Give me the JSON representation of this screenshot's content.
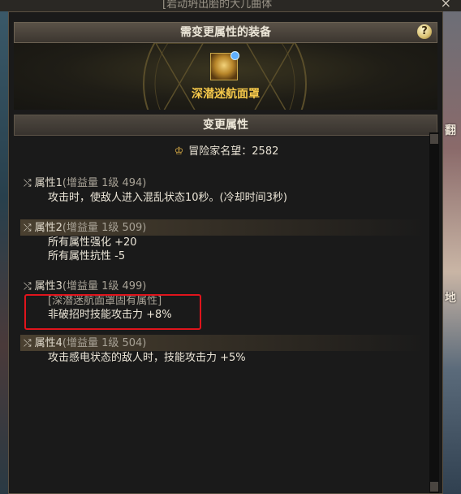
{
  "window": {
    "title": "[岩动坍出胎的大几曲体",
    "close_label": "×"
  },
  "equip_section": {
    "header": "需变更属性的装备",
    "help_label": "?",
    "item_name": "深潜迷航面罩"
  },
  "change_section": {
    "header": "变更属性",
    "fame_label": "冒险家名望：2582"
  },
  "attributes": [
    {
      "name": "属性1",
      "sub": "(增益量 1级 494)",
      "lines": [
        "攻击时，使敌人进入混乱状态10秒。(冷却时间3秒)"
      ]
    },
    {
      "name": "属性2",
      "sub": "(增益量 1级 509)",
      "lines": [
        "所有属性强化 +20",
        "所有属性抗性 -5"
      ]
    },
    {
      "name": "属性3",
      "sub": "(增益量 1级 499)",
      "lines": [
        "[深潜迷航面罩固有属性]",
        "非破招时技能攻击力 +8%"
      ]
    },
    {
      "name": "属性4",
      "sub": "(增益量 1级 504)",
      "lines": [
        "攻击感电状态的敌人时，技能攻击力 +5%"
      ]
    }
  ],
  "background_text": {
    "right_1": "翻",
    "right_2": "地"
  },
  "colors": {
    "item_name": "#f5c84a",
    "highlight_box": "#e0141c",
    "panel_border": "#5a5143"
  },
  "icons": {
    "fame": "crown-icon",
    "attr": "shuffle-icon",
    "help": "question-icon"
  }
}
